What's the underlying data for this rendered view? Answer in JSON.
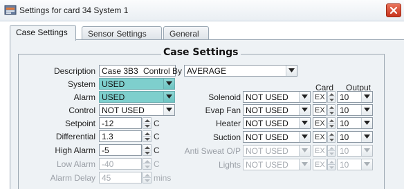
{
  "window": {
    "title": "Settings for card 34 System 1"
  },
  "tabs": [
    {
      "label": "Case Settings",
      "active": true
    },
    {
      "label": "Sensor Settings",
      "active": false
    },
    {
      "label": "General",
      "active": false
    }
  ],
  "group": {
    "title": "Case Settings"
  },
  "left": {
    "description": {
      "label": "Description",
      "value": "Case 3B3"
    },
    "system": {
      "label": "System",
      "value": "USED"
    },
    "alarm": {
      "label": "Alarm",
      "value": "USED"
    },
    "control": {
      "label": "Control",
      "value": "NOT USED"
    },
    "setpoint": {
      "label": "Setpoint",
      "value": "-12",
      "unit": "C"
    },
    "differential": {
      "label": "Differential",
      "value": "1.3",
      "unit": "C"
    },
    "high_alarm": {
      "label": "High Alarm",
      "value": "-5",
      "unit": "C"
    },
    "low_alarm": {
      "label": "Low Alarm",
      "value": "-40",
      "unit": "C"
    },
    "alarm_delay": {
      "label": "Alarm Delay",
      "value": "45",
      "unit": "mins"
    }
  },
  "right": {
    "control_by": {
      "label": "Control By",
      "value": "AVERAGE"
    },
    "col_card": "Card",
    "col_output": "Output",
    "rows": [
      {
        "label": "Solenoid",
        "value": "NOT USED",
        "card": "EX",
        "output": "10",
        "enabled": true
      },
      {
        "label": "Evap Fan",
        "value": "NOT USED",
        "card": "EX",
        "output": "10",
        "enabled": true
      },
      {
        "label": "Heater",
        "value": "NOT USED",
        "card": "EX",
        "output": "10",
        "enabled": true
      },
      {
        "label": "Suction",
        "value": "NOT USED",
        "card": "EX",
        "output": "10",
        "enabled": true
      },
      {
        "label": "Anti Sweat O/P",
        "value": "NOT USED",
        "card": "EX",
        "output": "10",
        "enabled": false
      },
      {
        "label": "Lights",
        "value": "NOT USED",
        "card": "EX",
        "output": "10",
        "enabled": false
      }
    ]
  },
  "colors": {
    "teal": "#7ecfcd",
    "close": "#d24a30",
    "panel": "#eef2f5"
  }
}
